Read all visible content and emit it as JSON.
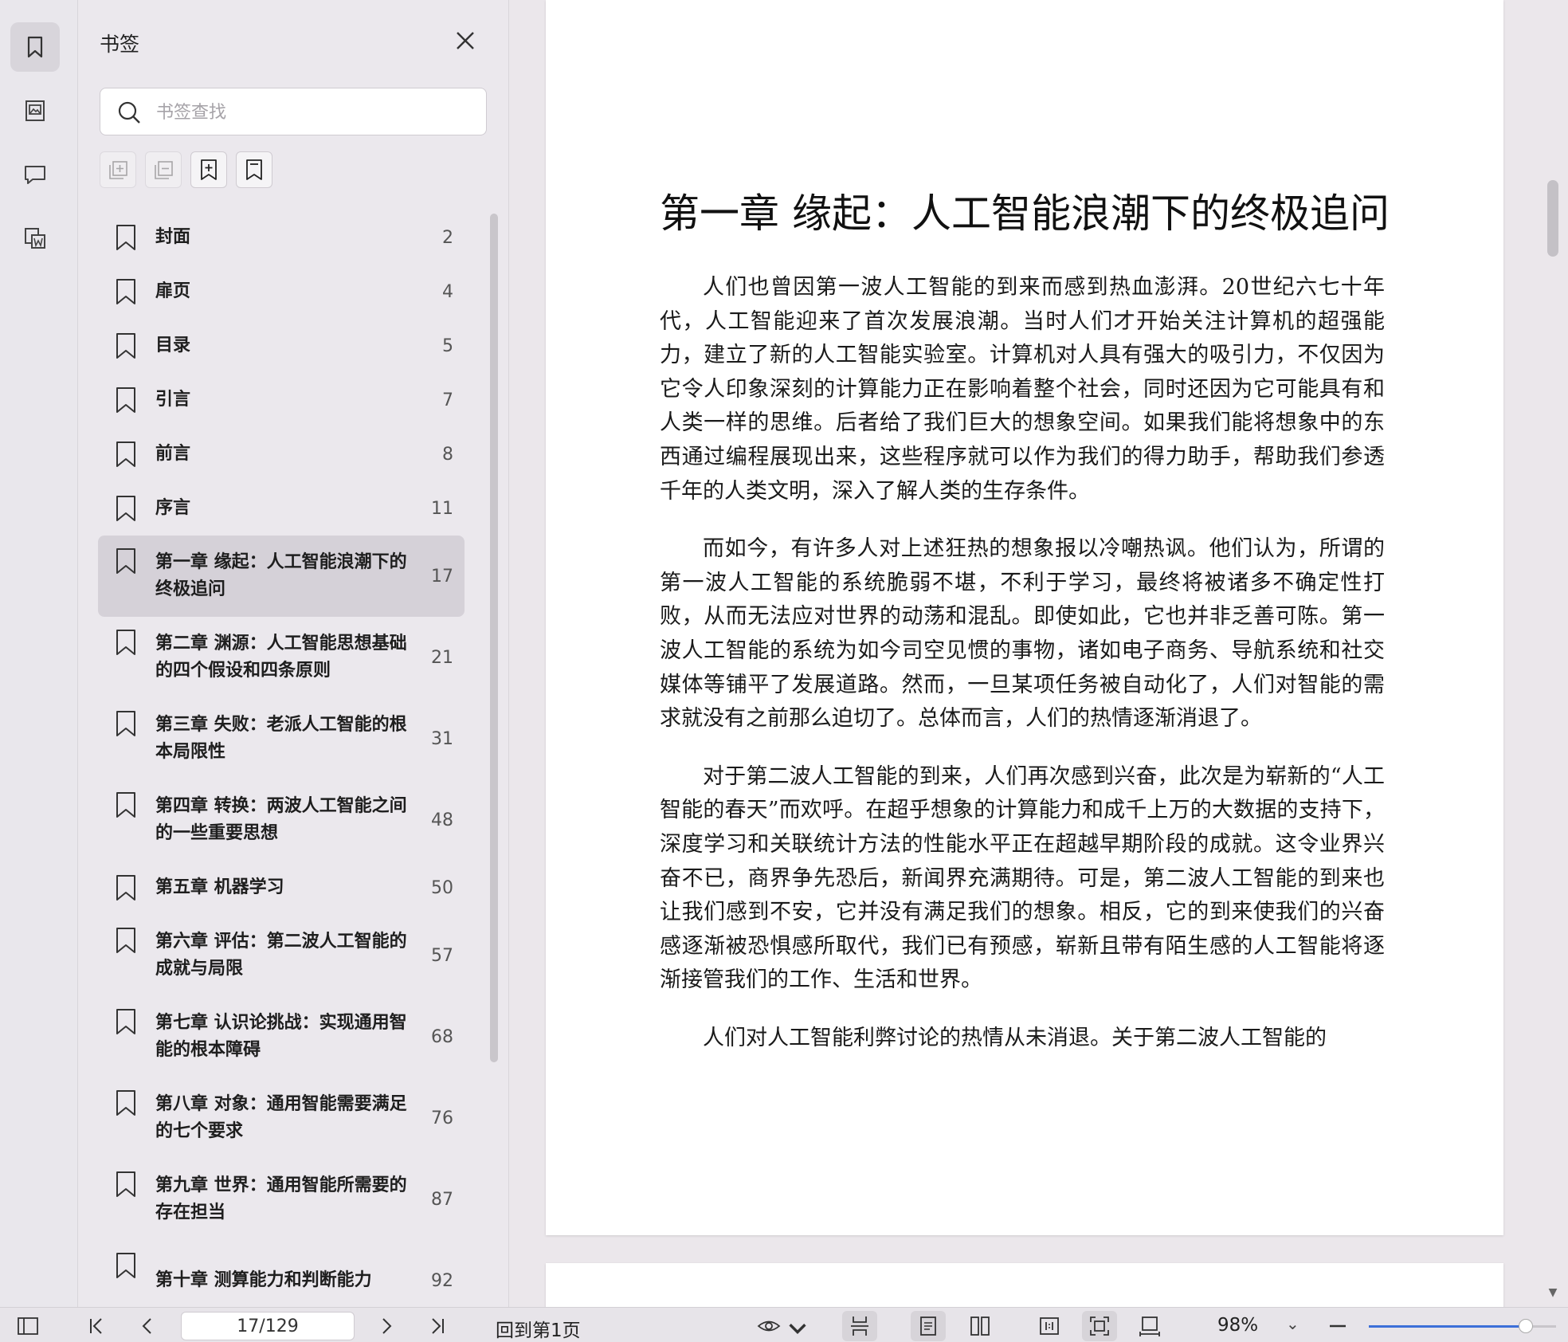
{
  "sidebar": {
    "title": "书签",
    "search": {
      "placeholder": "书签查找",
      "value": ""
    },
    "bookmarks": [
      {
        "label": "封面",
        "page": "2"
      },
      {
        "label": "扉页",
        "page": "4"
      },
      {
        "label": "目录",
        "page": "5"
      },
      {
        "label": "引言",
        "page": "7"
      },
      {
        "label": "前言",
        "page": "8"
      },
      {
        "label": "序言",
        "page": "11"
      },
      {
        "label": "第一章 缘起：人工智能浪潮下的终极追问",
        "page": "17"
      },
      {
        "label": "第二章 渊源：人工智能思想基础的四个假设和四条原则",
        "page": "21"
      },
      {
        "label": "第三章 失败：老派人工智能的根本局限性",
        "page": "31"
      },
      {
        "label": "第四章 转换：两波人工智能之间的一些重要思想",
        "page": "48"
      },
      {
        "label": "第五章 机器学习",
        "page": "50"
      },
      {
        "label": "第六章 评估：第二波人工智能的成就与局限",
        "page": "57"
      },
      {
        "label": "第七章 认识论挑战：实现通用智能的根本障碍",
        "page": "68"
      },
      {
        "label": "第八章 对象：通用智能需要满足的七个要求",
        "page": "76"
      },
      {
        "label": "第九章 世界：通用智能所需要的存在担当",
        "page": "87"
      },
      {
        "label": "第十章 测算能力和判断能力",
        "page": "92"
      }
    ],
    "selected_index": 6
  },
  "document": {
    "chapter_title": "第一章 缘起：人工智能浪潮下的终极追问",
    "paragraphs": [
      "人们也曾因第一波人工智能的到来而感到热血澎湃。20世纪六七十年代，人工智能迎来了首次发展浪潮。当时人们才开始关注计算机的超强能力，建立了新的人工智能实验室。计算机对人具有强大的吸引力，不仅因为它令人印象深刻的计算能力正在影响着整个社会，同时还因为它可能具有和人类一样的思维。后者给了我们巨大的想象空间。如果我们能将想象中的东西通过编程展现出来，这些程序就可以作为我们的得力助手，帮助我们参透千年的人类文明，深入了解人类的生存条件。",
      "而如今，有许多人对上述狂热的想象报以冷嘲热讽。他们认为，所谓的第一波人工智能的系统脆弱不堪，不利于学习，最终将被诸多不确定性打败，从而无法应对世界的动荡和混乱。即使如此，它也并非乏善可陈。第一波人工智能的系统为如今司空见惯的事物，诸如电子商务、导航系统和社交媒体等铺平了发展道路。然而，一旦某项任务被自动化了，人们对智能的需求就没有之前那么迫切了。总体而言，人们的热情逐渐消退了。",
      "对于第二波人工智能的到来，人们再次感到兴奋，此次是为崭新的“人工智能的春天”而欢呼。在超乎想象的计算能力和成千上万的大数据的支持下，深度学习和关联统计方法的性能水平正在超越早期阶段的成就。这令业界兴奋不已，商界争先恐后，新闻界充满期待。可是，第二波人工智能的到来也让我们感到不安，它并没有满足我们的想象。相反，它的到来使我们的兴奋感逐渐被恐惧感所取代，我们已有预感，崭新且带有陌生感的人工智能将逐渐接管我们的工作、生活和世界。",
      "人们对人工智能利弊讨论的热情从未消退。关于第二波人工智能的"
    ]
  },
  "statusbar": {
    "page_indicator": "17/129",
    "back_to_first": "回到第1页",
    "zoom": "98%",
    "zoom_fraction": 0.84
  }
}
